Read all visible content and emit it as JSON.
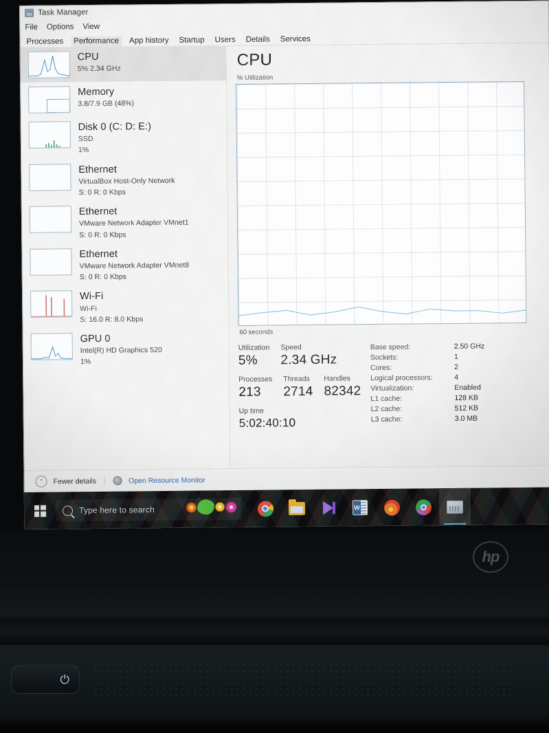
{
  "window": {
    "title": "Task Manager",
    "icon": "task-manager-icon",
    "menu": [
      "File",
      "Options",
      "View"
    ],
    "tabs": [
      {
        "label": "Processes",
        "active": false
      },
      {
        "label": "Performance",
        "active": true
      },
      {
        "label": "App history",
        "active": false
      },
      {
        "label": "Startup",
        "active": false
      },
      {
        "label": "Users",
        "active": false
      },
      {
        "label": "Details",
        "active": false
      },
      {
        "label": "Services",
        "active": false
      }
    ]
  },
  "sidebar": {
    "items": [
      {
        "name": "CPU",
        "sub1": "5%  2.34 GHz",
        "sub2": "",
        "selected": true,
        "spark": "cpu"
      },
      {
        "name": "Memory",
        "sub1": "3.8/7.9 GB (48%)",
        "sub2": "",
        "selected": false,
        "spark": "memory"
      },
      {
        "name": "Disk 0 (C: D: E:)",
        "sub1": "SSD",
        "sub2": "1%",
        "selected": false,
        "spark": "disk"
      },
      {
        "name": "Ethernet",
        "sub1": "VirtualBox Host-Only Network",
        "sub2": "S: 0  R: 0 Kbps",
        "selected": false,
        "spark": "flat"
      },
      {
        "name": "Ethernet",
        "sub1": "VMware Network Adapter VMnet1",
        "sub2": "S: 0  R: 0 Kbps",
        "selected": false,
        "spark": "flat"
      },
      {
        "name": "Ethernet",
        "sub1": "VMware Network Adapter VMnet8",
        "sub2": "S: 0  R: 0 Kbps",
        "selected": false,
        "spark": "flat"
      },
      {
        "name": "Wi-Fi",
        "sub1": "Wi-Fi",
        "sub2": "S: 16.0  R: 8.0 Kbps",
        "selected": false,
        "spark": "wifi"
      },
      {
        "name": "GPU 0",
        "sub1": "Intel(R) HD Graphics 520",
        "sub2": "1%",
        "selected": false,
        "spark": "gpu"
      }
    ]
  },
  "main": {
    "heading": "CPU",
    "graph_top_label": "% Utilization",
    "graph_bottom_label": "60 seconds",
    "stats_left": [
      {
        "label": "Utilization",
        "value": "5%"
      },
      {
        "label": "Speed",
        "value": "2.34 GHz"
      },
      {
        "label": "Processes",
        "value": "213"
      },
      {
        "label": "Threads",
        "value": "2714"
      },
      {
        "label": "Handles",
        "value": "82342"
      },
      {
        "label": "Up time",
        "value": "5:02:40:10"
      }
    ],
    "specs": [
      {
        "label": "Base speed:",
        "value": "2.50 GHz"
      },
      {
        "label": "Sockets:",
        "value": "1"
      },
      {
        "label": "Cores:",
        "value": "2"
      },
      {
        "label": "Logical processors:",
        "value": "4"
      },
      {
        "label": "Virtualization:",
        "value": "Enabled"
      },
      {
        "label": "L1 cache:",
        "value": "128 KB"
      },
      {
        "label": "L2 cache:",
        "value": "512 KB"
      },
      {
        "label": "L3 cache:",
        "value": "3.0 MB"
      }
    ]
  },
  "footer": {
    "fewer_details": "Fewer details",
    "resource_monitor": "Open Resource Monitor",
    "chevron": "⌃"
  },
  "taskbar": {
    "search_placeholder": "Type here to search",
    "apps": [
      "Google Chrome",
      "File Explorer",
      "Visual Studio",
      "Microsoft Word",
      "Mozilla Firefox",
      "Chrome Canary",
      "Task Manager"
    ]
  },
  "device": {
    "brand": "hp",
    "power_glyph": "⏻"
  },
  "chart_data": {
    "type": "line",
    "title": "CPU",
    "ylabel": "% Utilization",
    "xlabel": "60 seconds",
    "ylim": [
      0,
      100
    ],
    "xlim": [
      60,
      0
    ],
    "grid": true,
    "series": [
      {
        "name": "% Utilization",
        "color": "#0b6a9e",
        "x": [
          0,
          5,
          10,
          15,
          20,
          25,
          30,
          35,
          40,
          45,
          50,
          55,
          60
        ],
        "values": [
          4,
          5,
          6,
          4,
          5,
          7,
          5,
          4,
          6,
          5,
          5,
          4,
          5
        ]
      }
    ],
    "current_value": 5,
    "legend": "none"
  }
}
